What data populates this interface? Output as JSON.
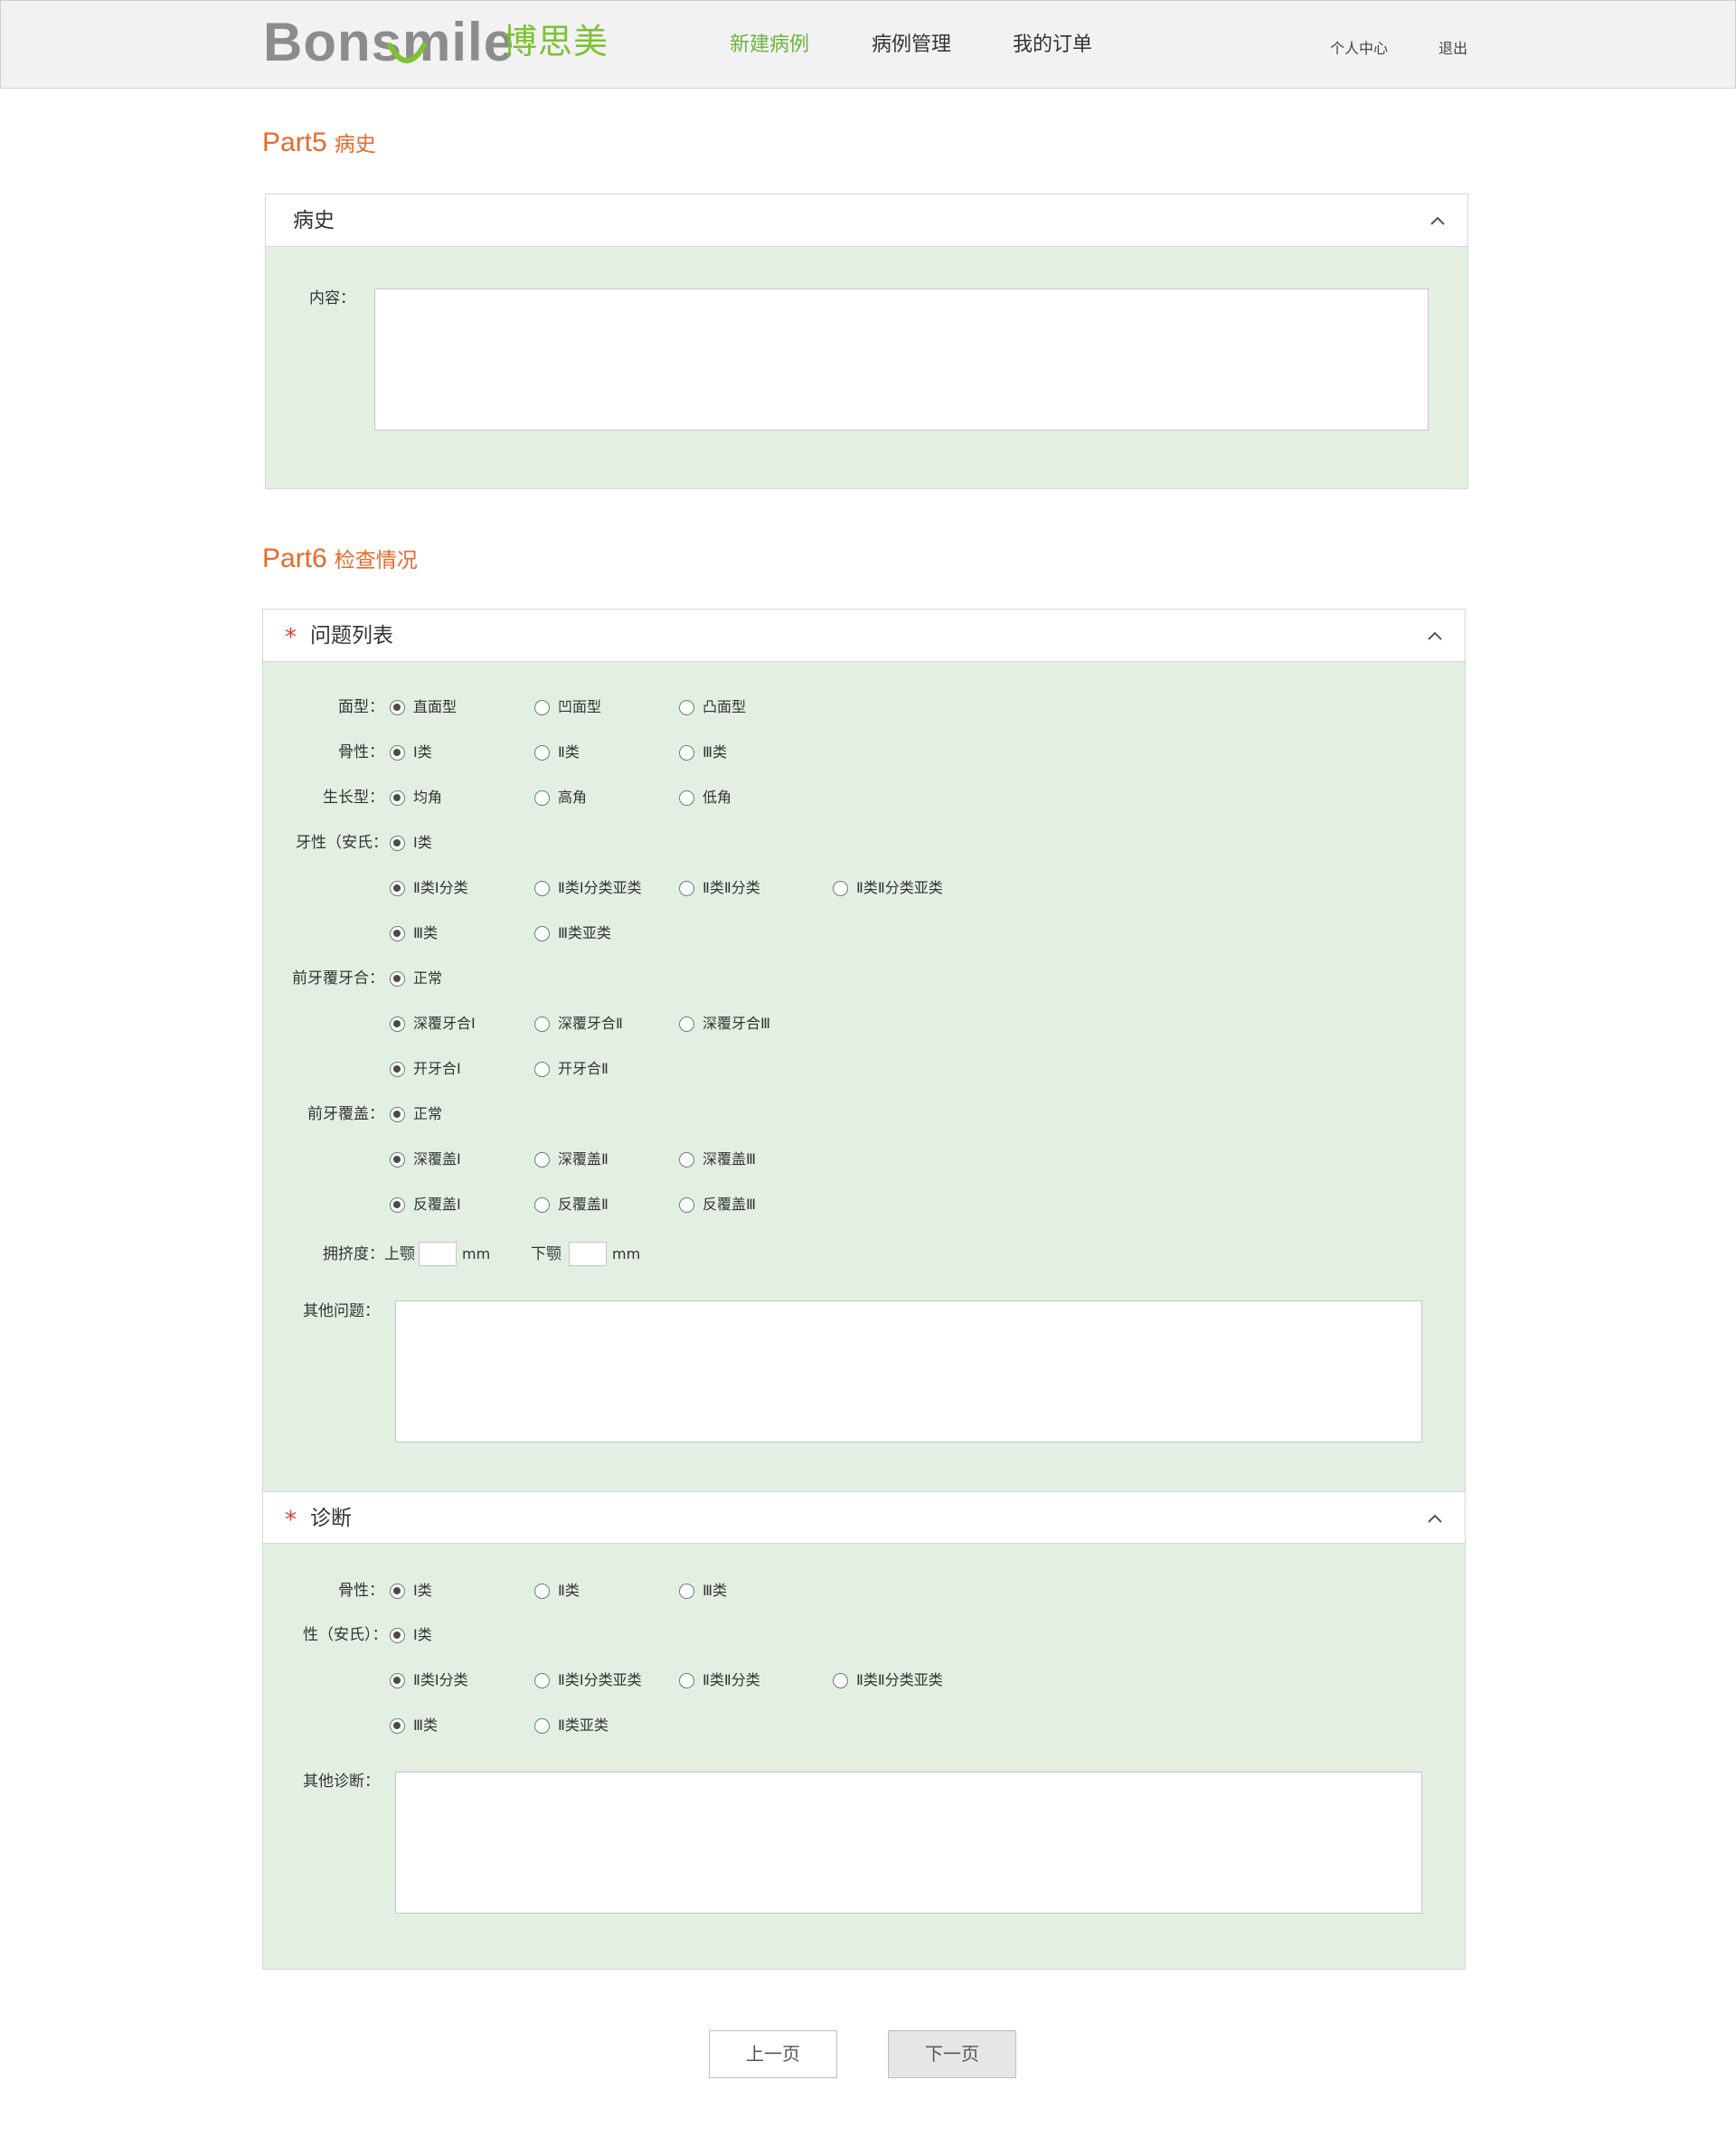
{
  "brand": {
    "name_en": "Bonsmile",
    "name_cn": "博思美",
    "accent": "#7cc233"
  },
  "nav": {
    "new_case": "新建病例",
    "case_manage": "病例管理",
    "my_orders": "我的订单",
    "user_center": "个人中心",
    "logout": "退出"
  },
  "part5": {
    "num": "Part5",
    "name": "病史",
    "panel_title": "病史",
    "content_label": "内容："
  },
  "part6": {
    "num": "Part6",
    "name": "检查情况"
  },
  "problems": {
    "title": "问题列表",
    "required": "*",
    "face_label": "面型：",
    "face": [
      "直面型",
      "凹面型",
      "凸面型"
    ],
    "skeletal_label": "骨性：",
    "skeletal": [
      "Ⅰ类",
      "Ⅱ类",
      "Ⅲ类"
    ],
    "growth_label": "生长型：",
    "growth": [
      "均角",
      "高角",
      "低角"
    ],
    "dental_label": "牙性（安氏：",
    "dental_r1": [
      "Ⅰ类"
    ],
    "dental_r2": [
      "Ⅱ类Ⅰ分类",
      "Ⅱ类Ⅰ分类亚类",
      "Ⅱ类Ⅱ分类",
      "Ⅱ类Ⅱ分类亚类"
    ],
    "dental_r3": [
      "Ⅲ类",
      "Ⅲ类亚类"
    ],
    "overbite_label": "前牙覆牙合：",
    "overbite_r1": [
      "正常"
    ],
    "overbite_r2": [
      "深覆牙合Ⅰ",
      "深覆牙合Ⅱ",
      "深覆牙合Ⅲ"
    ],
    "overbite_r3": [
      "开牙合Ⅰ",
      "开牙合Ⅱ"
    ],
    "overjet_label": "前牙覆盖：",
    "overjet_r1": [
      "正常"
    ],
    "overjet_r2": [
      "深覆盖Ⅰ",
      "深覆盖Ⅱ",
      "深覆盖Ⅲ"
    ],
    "overjet_r3": [
      "反覆盖Ⅰ",
      "反覆盖Ⅱ",
      "反覆盖Ⅲ"
    ],
    "crowding_label": "拥挤度：上颚",
    "lower_label": "下颚",
    "unit": "mm",
    "other_label": "其他问题："
  },
  "diagnosis": {
    "title": "诊断",
    "required": "*",
    "skeletal_label": "骨性：",
    "skeletal": [
      "Ⅰ类",
      "Ⅱ类",
      "Ⅲ类"
    ],
    "dental_label": "性（安氏）：",
    "dental_r1": [
      "Ⅰ类"
    ],
    "dental_r2": [
      "Ⅱ类Ⅰ分类",
      "Ⅱ类Ⅰ分类亚类",
      "Ⅱ类Ⅱ分类",
      "Ⅱ类Ⅱ分类亚类"
    ],
    "dental_r3": [
      "Ⅲ类",
      "Ⅱ类亚类"
    ],
    "other_label": "其他诊断："
  },
  "buttons": {
    "prev": "上一页",
    "next": "下一页"
  }
}
